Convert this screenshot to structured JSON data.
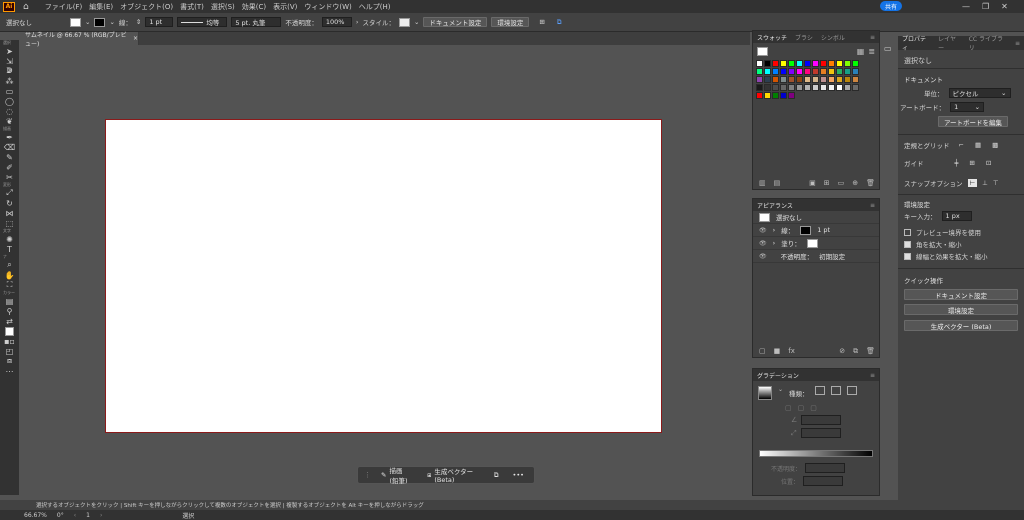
{
  "app": {
    "logo": "Ai",
    "share_label": "共有"
  },
  "menu": [
    "ファイル(F)",
    "編集(E)",
    "オブジェクト(O)",
    "書式(T)",
    "選択(S)",
    "効果(C)",
    "表示(V)",
    "ウィンドウ(W)",
    "ヘルプ(H)"
  ],
  "control_bar": {
    "selection": "選択なし",
    "stroke_label": "線：",
    "stroke_width": "1 pt",
    "stroke_profile": "均等",
    "brush": "5 pt. 丸筆",
    "opacity_label": "不透明度：",
    "opacity_value": "100%",
    "style_label": "スタイル：",
    "doc_setup_button": "ドキュメント設定",
    "prefs_button": "環境設定"
  },
  "document": {
    "tab_title": "サムネイル @ 66.67 % (RGB/プレビュー)",
    "tab_close": "×"
  },
  "tool_labels": {
    "select": "選択",
    "draw": "描画",
    "modify": "変形",
    "type": "文字",
    "nav": "ナ",
    "color": "カラー"
  },
  "context_bar": {
    "draw_button": "描画 (鉛筆)",
    "genvec_button": "生成ベクター (Beta)",
    "more": "•••"
  },
  "status": {
    "hint": "選択するオブジェクトをクリック | Shift キーを押しながらクリックして複数のオブジェクトを選択 | 複製するオブジェクトを Alt キーを押しながらドラッグ"
  },
  "bottom": {
    "zoom": "66.67%",
    "rotate": "0°",
    "artboard": "1",
    "mode": "選択"
  },
  "swatches_panel": {
    "tabs": [
      "スウォッチ",
      "ブラシ",
      "シンボル"
    ],
    "rows": [
      [
        "#ffffff",
        "#000000",
        "#ff0000",
        "#ffff00",
        "#00ff00",
        "#00ffff",
        "#0000ff",
        "#ff00ff",
        "#ff0000",
        "#ff7f00",
        "#ffff00",
        "#7fff00",
        "#00ff00"
      ],
      [
        "#00ff7f",
        "#00ffff",
        "#007fff",
        "#0000ff",
        "#7f00ff",
        "#ff00ff",
        "#ff007f",
        "#c0392b",
        "#e67e22",
        "#f1c40f",
        "#27ae60",
        "#16a085",
        "#2980b9"
      ],
      [
        "#8e44ad",
        "#2c3e50",
        "#d35400",
        "#7f8c8d",
        "#a0522d",
        "#8b4513",
        "#deb887",
        "#d2b48c",
        "#bc8f8f",
        "#f4a460",
        "#daa520",
        "#b8860b",
        "#cd853f"
      ],
      [
        "#1a1a1a",
        "#333333",
        "#4d4d4d",
        "#666666",
        "#808080",
        "#999999",
        "#b3b3b3",
        "#cccccc",
        "#e6e6e6",
        "#f2f2f2",
        "#ffffff",
        "#a9a9a9",
        "#696969"
      ],
      [
        "#ff0000",
        "#ffd700",
        "#008000",
        "#0000cd",
        "#800080"
      ]
    ]
  },
  "appearance_panel": {
    "tab": "アピアランス",
    "selection": "選択なし",
    "stroke_label": "線：",
    "stroke_value": "1 pt",
    "fill_label": "塗り：",
    "opacity_label": "不透明度：",
    "opacity_value": "初期設定"
  },
  "gradient_panel": {
    "tab": "グラデーション",
    "type_label": "種類：",
    "opacity_label": "不透明度：",
    "location_label": "位置："
  },
  "properties_panel": {
    "tabs": [
      "プロパティ",
      "レイヤー",
      "CC ライブラリ"
    ],
    "selection": "選択なし",
    "document_title": "ドキュメント",
    "units_label": "単位：",
    "units_value": "ピクセル",
    "artboard_label": "アートボード：",
    "artboard_value": "1",
    "edit_artboards_button": "アートボードを編集",
    "rulers_grids_label": "定規とグリッド",
    "guides_label": "ガイド",
    "snap_label": "スナップオプション",
    "prefs_title": "環境設定",
    "key_increment_label": "キー入力：",
    "key_increment_value": "1 px",
    "preview_bounds_label": "プレビュー境界を使用",
    "scale_corners_label": "角を拡大・縮小",
    "scale_strokes_label": "線幅と効果を拡大・縮小",
    "quick_actions_title": "クイック操作",
    "qa_doc_setup": "ドキュメント設定",
    "qa_prefs": "環境設定",
    "qa_genvec": "生成ベクター (Beta)"
  },
  "colors": {
    "artboard_border": "#8b1a1a",
    "accent": "#1473e6",
    "ui_bg": "#535353"
  }
}
